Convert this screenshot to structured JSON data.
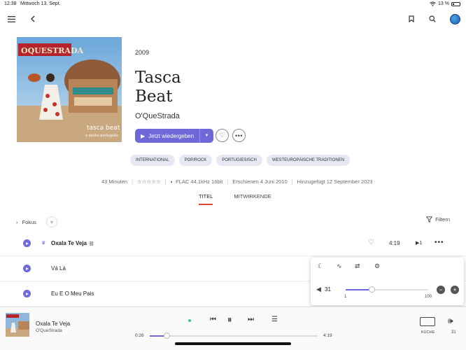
{
  "status_bar": {
    "time": "12:38",
    "date": "Mittwoch 13. Sept.",
    "battery": "13 %"
  },
  "album": {
    "year": "2009",
    "title_line1": "Tasca",
    "title_line2": "Beat",
    "artist": "O'QueStrada",
    "play_label": "Jetzt wiedergeben",
    "cover_text_band": "OQUESTRADA",
    "cover_text_title": "tasca beat",
    "cover_text_sub": "o sonho português"
  },
  "tags": [
    "INTERNATIONAL",
    "POP/ROCK",
    "PORTUGIESISCH",
    "WESTEUROPÄISCHE TRADITIONEN"
  ],
  "info": {
    "duration": "43 Minuten",
    "stars": "☆☆☆☆☆",
    "format": "FLAC 44.1kHz 16bit",
    "released": "Erschienen 4 Juni 2010",
    "added": "Hinzugefügt 12 September 2023"
  },
  "tabs": [
    "TITEL",
    "MITWIRKENDE"
  ],
  "toolbar": {
    "focus_label": "Fokus",
    "filter_label": "Filtern"
  },
  "tracks": [
    {
      "title": "Oxala Te Veja",
      "duration": "4:19",
      "plays": "1"
    },
    {
      "title": "Vá Lá"
    },
    {
      "title": "Eu E O Meu Pais"
    }
  ],
  "volume_popup": {
    "value": "31",
    "min": "1",
    "max": "100",
    "level": 0.31
  },
  "player": {
    "title": "Oxala Te Veja",
    "artist": "O'QueStrada",
    "elapsed": "0:26",
    "total": "4:19",
    "progress": 0.1,
    "zone": "KÜCHE",
    "volume": "31"
  },
  "colors": {
    "accent": "#6e68d8",
    "tab_indicator": "#e0473a",
    "playing_dot": "#39c79a"
  }
}
